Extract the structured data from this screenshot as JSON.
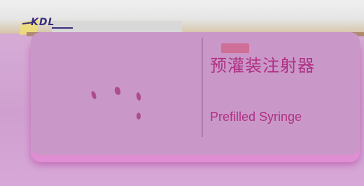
{
  "brand": {
    "logo_text": "KDL",
    "logo_icon": "kdl-logo"
  },
  "product": {
    "title_zh": "预灌装注射器",
    "title_en": "Prefilled Syringe"
  },
  "colors": {
    "accent": "#b02f83",
    "background": "#cfa3cf",
    "card": "#c998c9"
  }
}
